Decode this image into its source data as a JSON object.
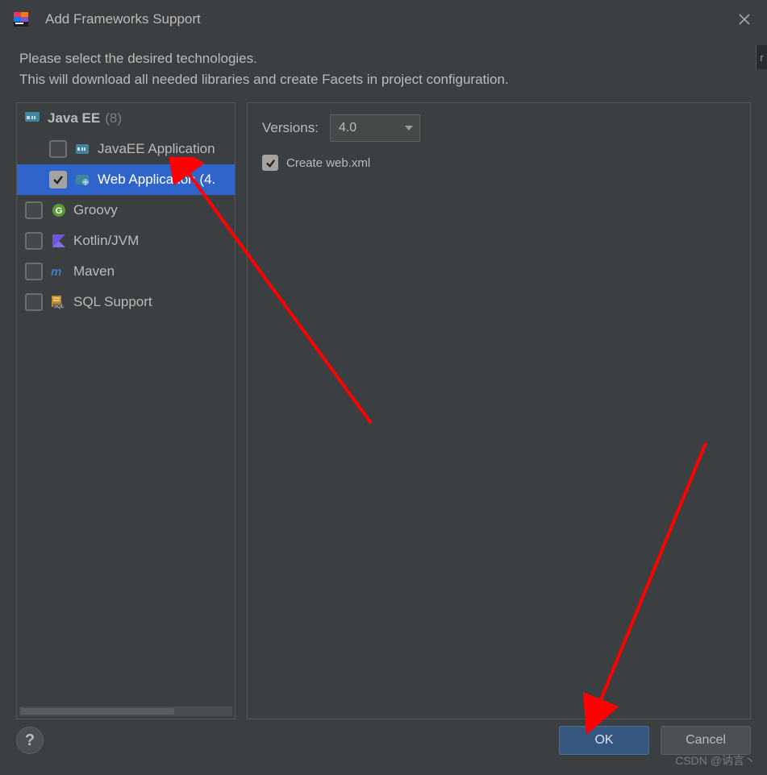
{
  "dialog": {
    "title": "Add Frameworks Support",
    "description_line1": "Please select the desired technologies.",
    "description_line2": "This will download all needed libraries and create Facets in project configuration."
  },
  "tree": {
    "header": {
      "label": "Java EE",
      "count": "(8)",
      "icon": "javaee-folder-icon"
    },
    "items": [
      {
        "label": "JavaEE Application",
        "checked": false,
        "icon": "javaee-icon",
        "indent": "child",
        "selected": false
      },
      {
        "label": "Web Application (4.",
        "checked": true,
        "icon": "web-icon",
        "indent": "child",
        "selected": true
      },
      {
        "label": "Groovy",
        "checked": false,
        "icon": "groovy-icon",
        "indent": "top",
        "selected": false
      },
      {
        "label": "Kotlin/JVM",
        "checked": false,
        "icon": "kotlin-icon",
        "indent": "top",
        "selected": false
      },
      {
        "label": "Maven",
        "checked": false,
        "icon": "maven-icon",
        "indent": "top",
        "selected": false
      },
      {
        "label": "SQL Support",
        "checked": false,
        "icon": "sql-icon",
        "indent": "top",
        "selected": false
      }
    ]
  },
  "right": {
    "versions_label": "Versions:",
    "versions_value": "4.0",
    "create_webxml_label": "Create web.xml",
    "create_webxml_checked": true
  },
  "footer": {
    "help_label": "?",
    "ok_label": "OK",
    "cancel_label": "Cancel"
  },
  "watermark": "CSDN @讷言丶",
  "colors": {
    "bg": "#3c3f41",
    "border": "#555555",
    "selection": "#2f65ca",
    "primaryBtn": "#365880",
    "arrow": "#ff0000"
  }
}
